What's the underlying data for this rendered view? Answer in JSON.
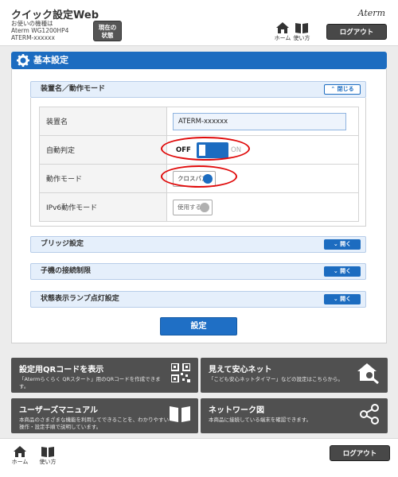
{
  "header": {
    "app_title": "クイック設定Web",
    "device_label": "お使いの機種は",
    "model": "Aterm WG1200HP4",
    "device_name": "ATERM-xxxxxx",
    "status_button": [
      "現在の",
      "状態"
    ],
    "brand": "Aterm",
    "home_label": "ホーム",
    "help_label": "使い方",
    "logout_label": "ログアウト"
  },
  "section": {
    "title": "基本設定"
  },
  "accordion_main": {
    "title": "装置名／動作モード",
    "toggle_label": "閉じる"
  },
  "settings": {
    "device_name": {
      "label": "装置名",
      "value": "ATERM-xxxxxx"
    },
    "auto_detect": {
      "label": "自動判定",
      "off_label": "OFF",
      "on_label": "ON",
      "state": "OFF"
    },
    "operation_mode": {
      "label": "動作モード",
      "value": "クロスパス"
    },
    "ipv6_mode": {
      "label": "IPv6動作モード",
      "value": "使用する"
    }
  },
  "collapsed_sections": [
    {
      "title": "ブリッジ設定",
      "toggle_label": "開く"
    },
    {
      "title": "子機の接続制限",
      "toggle_label": "開く"
    },
    {
      "title": "状態表示ランプ点灯設定",
      "toggle_label": "開く"
    }
  ],
  "save_button": "設定",
  "tiles": [
    {
      "title": "設定用QRコードを表示",
      "desc": "「Atermらくらく QRスタート」用のQRコードを作成できます。",
      "icon": "qr-code-icon"
    },
    {
      "title": "見えて安心ネット",
      "desc": "「こども安心ネットタイマー」などの設定はこちらから。",
      "icon": "house-search-icon"
    },
    {
      "title": "ユーザーズマニュアル",
      "desc": "本商品のさまざまな機能を利用してできることを、わかりやすい操作・設定手順で説明しています。",
      "icon": "book-icon"
    },
    {
      "title": "ネットワーク図",
      "desc": "本商品に接続している端末を確認できます。",
      "icon": "network-icon"
    }
  ],
  "colors": {
    "primary": "#1c6cc0",
    "header_bar": "#1c6cc0",
    "tile_bg": "#505050",
    "highlight": "#e00a0a"
  }
}
